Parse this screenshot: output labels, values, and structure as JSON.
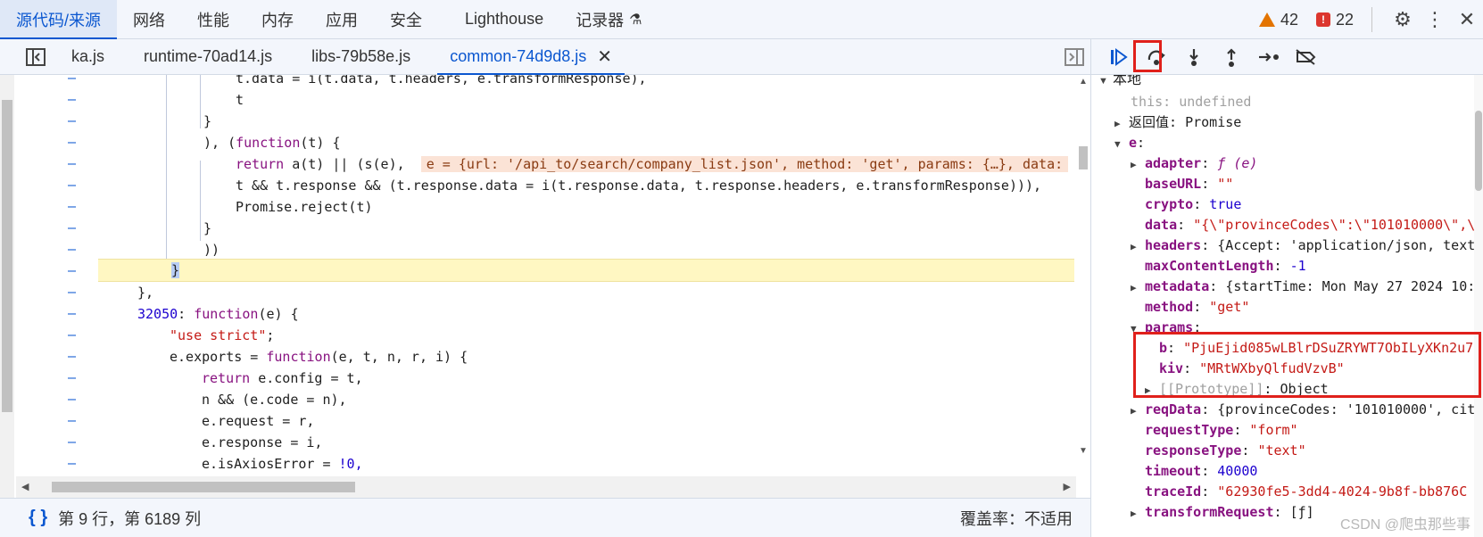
{
  "top_tabs": [
    "源代码/来源",
    "网络",
    "性能",
    "内存",
    "应用",
    "安全",
    "Lighthouse",
    "记录器"
  ],
  "warnings_count": "42",
  "errors_count": "22",
  "file_tabs": [
    "ka.js",
    "runtime-70ad14.js",
    "libs-79b58e.js",
    "common-74d9d8.js"
  ],
  "code": {
    "l1": "t.data = i(t.data, t.headers, e.transformResponse),",
    "l2": "t",
    "l3": "}",
    "l4a": "), (",
    "l4b": "function",
    "l4c": "(t) {",
    "l5a": "return",
    "l5b": " a(t) || (s(e),",
    "l5inline": "e = {url: '/api_to/search/company_list.json', method: 'get', params: {…}, data:",
    "l6": "t && t.response && (t.response.data = i(t.response.data, t.response.headers, e.transformResponse))),",
    "l7": "Promise.reject(t)",
    "l8": "}",
    "l9": "))",
    "l10": "}",
    "l11": "},",
    "l12a": "32050",
    "l12b": ": ",
    "l12c": "function",
    "l12d": "(e) {",
    "l13": "\"use strict\"",
    "l13b": ";",
    "l14a": "e.exports = ",
    "l14b": "function",
    "l14c": "(e, t, n, r, i) {",
    "l15a": "return",
    "l15b": " e.config = t,",
    "l16": "n && (e.code = n),",
    "l17": "e.request = r,",
    "l18": "e.response = i,",
    "l19a": "e.isAxiosError = ",
    "l19b": "!0,"
  },
  "gutter_marker": "–",
  "status": {
    "position": "第 9 行，第 6189 列",
    "coverage": "覆盖率：不适用"
  },
  "scope": {
    "local": "本地",
    "this_key": "this",
    "this_val": "undefined",
    "return_key": "返回值",
    "return_val": "Promise",
    "e_key": "e",
    "adapter_key": "adapter",
    "adapter_val": "ƒ (e)",
    "baseURL_key": "baseURL",
    "baseURL_val": "\"\"",
    "crypto_key": "crypto",
    "crypto_val": "true",
    "data_key": "data",
    "data_val": "\"{\\\"provinceCodes\\\":\\\"101010000\\\",\\",
    "headers_key": "headers",
    "headers_val": "{Accept: 'application/json, text",
    "maxlen_key": "maxContentLength",
    "maxlen_val": "-1",
    "metadata_key": "metadata",
    "metadata_val": "{startTime: Mon May 27 2024 10:",
    "method_key": "method",
    "method_val": "\"get\"",
    "params_key": "params",
    "b_key": "b",
    "b_val": "\"PjuEjid085wLBlrDSuZRYWT7ObILyXKn2u7",
    "kiv_key": "kiv",
    "kiv_val": "\"MRtWXbyQlfudVzvB\"",
    "proto_key": "[[Prototype]]",
    "proto_val": "Object",
    "reqData_key": "reqData",
    "reqData_val": "{provinceCodes: '101010000', cit",
    "requestType_key": "requestType",
    "requestType_val": "\"form\"",
    "responseType_key": "responseType",
    "responseType_val": "\"text\"",
    "timeout_key": "timeout",
    "timeout_val": "40000",
    "traceId_key": "traceId",
    "traceId_val": "\"62930fe5-3dd4-4024-9b8f-bb876C",
    "transform_key": "transformRequest",
    "transform_val": "[ƒ]"
  },
  "watermark": "CSDN @爬虫那些事"
}
